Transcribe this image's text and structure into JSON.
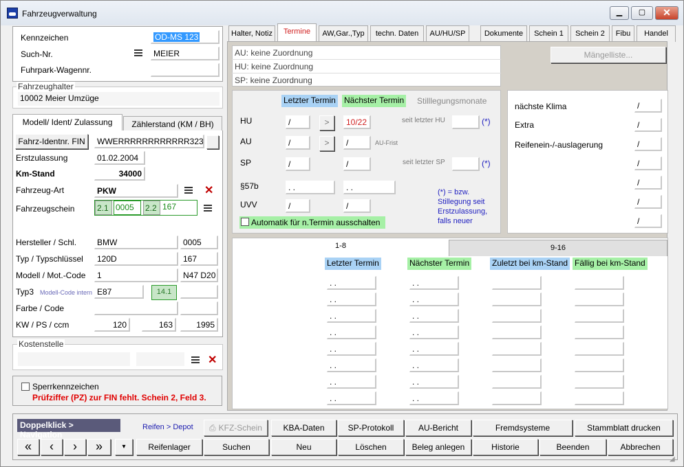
{
  "window": {
    "title": "Fahrzeugverwaltung",
    "min_icon": "minimize-icon",
    "max_icon": "maximize-icon",
    "close_icon": "close-icon"
  },
  "left": {
    "kennzeichen_label": "Kennzeichen",
    "kennzeichen": "OD-MS 123",
    "suchnr_label": "Such-Nr.",
    "suchnr": "MEIER",
    "fuhrpark_label": "Fuhrpark-Wagennr.",
    "fuhrpark": "",
    "halter_group": "Fahrzeughalter",
    "halter": "10002 Meier Umzüge",
    "tabs": [
      "Modell/ Ident/ Zulassung",
      "Zählerstand (KM / BH)"
    ],
    "fin_btn": "Fahrz-Identnr. FIN",
    "fin": "WWERRRRRRRRRRRR323",
    "ez_label": "Erstzulassung",
    "ez": "01.02.2004",
    "km_label": "Km-Stand",
    "km": "34000",
    "art_label": "Fahrzeug-Art",
    "art": "PKW",
    "schein_label": "Fahrzeugschein",
    "schein": [
      "2.1",
      "0005",
      "2.2",
      "167"
    ],
    "hersteller_label": "Hersteller / Schl.",
    "hersteller": "BMW",
    "hersteller_code": "0005",
    "typ_label": "Typ / Typschlüssel",
    "typ": "120D",
    "typ_code": "167",
    "modell_label": "Modell / Mot.-Code",
    "modell": "1",
    "motcode": "N47 D20",
    "typ3_label": "Typ3",
    "typ3_hint": "Modell-Code intern",
    "typ3": "E87",
    "typ3_badge": "14.1",
    "farbe_label": "Farbe / Code",
    "kw_label": "KW / PS / ccm",
    "kw": "120",
    "ps": "163",
    "ccm": "1995",
    "kosten_group": "Kostenstelle",
    "sperr_label": "Sperrkennzeichen",
    "warning": "Prüfziffer (PZ) zur FIN fehlt. Schein 2, Feld 3."
  },
  "tabs": [
    "Halter, Notiz",
    "Termine",
    "AW,Gar.,Typ",
    "techn. Daten",
    "AU/HU/SP",
    "Dokumente",
    "Schein 1",
    "Schein 2",
    "Fibu",
    "Handel"
  ],
  "assign": [
    "AU: keine Zuordnung",
    "HU: keine Zuordnung",
    "SP: keine Zuordnung"
  ],
  "maengel_btn": "Mängelliste...",
  "termine": {
    "h_letzter": "Letzter Termin",
    "h_naechster": "Nächster Termin",
    "h_still": "Stilllegungsmonate",
    "rows": [
      "HU",
      "AU",
      "SP",
      "§57b",
      "UVV"
    ],
    "hu_last": "/",
    "hu_next": "10/22",
    "hu_seit": "seit letzter HU",
    "star": "(*)",
    "au_last": "/",
    "au_next": "/",
    "au_frist": "AU-Frist",
    "sp_last": "/",
    "sp_next": "/",
    "sp_seit": "seit letzter SP",
    "p57_last": ". .",
    "p57_next": ". .",
    "uvv_last": "/",
    "uvv_next": "/",
    "note": "(*) = bzw. Stillegung seit Erstzulassung, falls neuer",
    "auto": "Automatik für n.Termin ausschalten"
  },
  "right_box": {
    "labels": [
      "nächste Klima",
      "Extra",
      "Reifenein-/-auslagerung"
    ],
    "values": [
      "/",
      "/",
      "/",
      "/",
      "/",
      "/",
      "/"
    ]
  },
  "bottom_tabs": [
    "1-8",
    "9-16"
  ],
  "bottom_headers": [
    "Letzter Termin",
    "Nächster Termin",
    "Zuletzt bei km-Stand",
    "Fällig bei km-Stand"
  ],
  "bottom_rows": [
    ". .",
    ". .",
    ". .",
    ". .",
    ". .",
    ". .",
    ". .",
    ". ."
  ],
  "footer": {
    "nav_title": "Doppelklick > Navigation",
    "reifen_link": "Reifen > Depot",
    "row1": [
      "KFZ-Schein",
      "KBA-Daten",
      "SP-Protokoll",
      "AU-Bericht",
      "Fremdsysteme",
      "Stammblatt drucken"
    ],
    "nav": [
      "«",
      "‹",
      "›",
      "»",
      "▾"
    ],
    "row2": [
      "Reifenlager",
      "Suchen",
      "Neu",
      "Löschen",
      "Beleg anlegen",
      "Historie",
      "Beenden",
      "Abbrechen"
    ]
  }
}
